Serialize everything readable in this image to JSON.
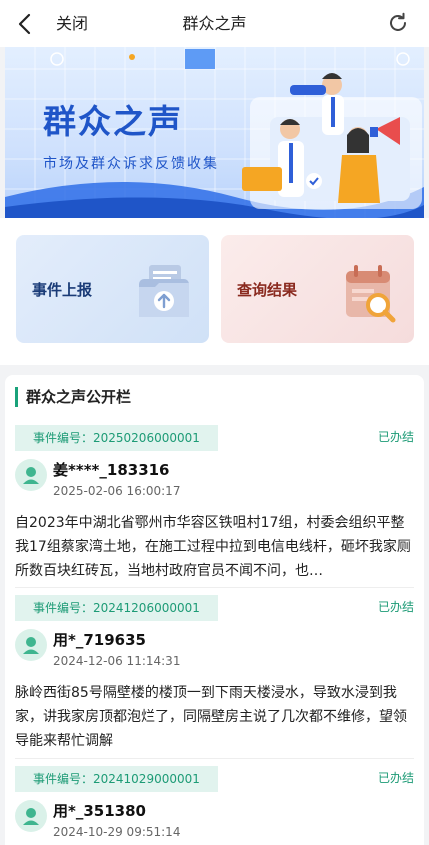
{
  "header": {
    "close_label": "关闭",
    "title": "群众之声",
    "back_icon": "chevron-left-icon",
    "refresh_icon": "refresh-icon"
  },
  "banner": {
    "title": "群众之声",
    "subtitle": "市场及群众诉求反馈收集"
  },
  "actions": [
    {
      "label": "事件上报",
      "icon": "upload-folder-icon"
    },
    {
      "label": "查询结果",
      "icon": "search-document-icon"
    }
  ],
  "public_section": {
    "title": "群众之声公开栏",
    "records": [
      {
        "event_no": "事件编号：20250206000001",
        "status": "已办结",
        "user": "姜****_183316",
        "time": "2025-02-06 16:00:17",
        "content": "自2023年中湖北省鄂州市华容区铁咀村17组，村委会组织平整我17组蔡家湾土地，在施工过程中拉到电信电线杆，砸坏我家厕所数百块红砖瓦，当地村政府官员不闻不问，也…"
      },
      {
        "event_no": "事件编号：20241206000001",
        "status": "已办结",
        "user": "用*_719635",
        "time": "2024-12-06 11:14:31",
        "content": "脉岭西街85号隔壁楼的楼顶一到下雨天楼浸水，导致水浸到我家，讲我家房顶都泡烂了，同隔壁房主说了几次都不维修，望领导能来帮忙调解"
      },
      {
        "event_no": "事件编号：20241029000001",
        "status": "已办结",
        "user": "用*_351380",
        "time": "2024-10-29 09:51:14",
        "content": ""
      }
    ]
  },
  "colors": {
    "accent_green": "#1d9b76",
    "banner_blue": "#1f55c8"
  }
}
